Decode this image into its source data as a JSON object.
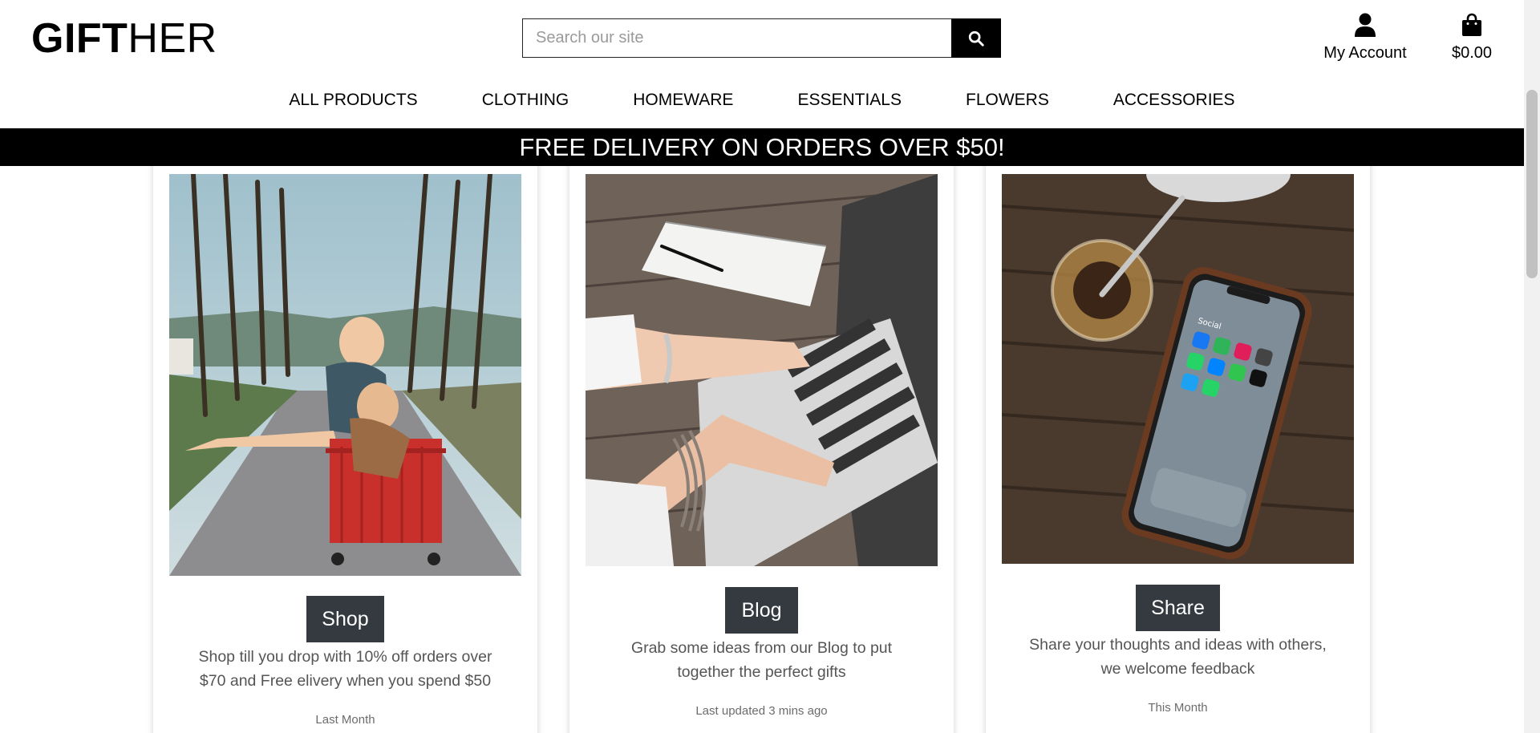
{
  "header": {
    "logo_bold": "GIFT",
    "logo_light": "HER",
    "search_placeholder": "Search our site",
    "account_label": "My Account",
    "cart_total": "$0.00"
  },
  "nav": {
    "items": [
      "ALL PRODUCTS",
      "CLOTHING",
      "HOMEWARE",
      "ESSENTIALS",
      "FLOWERS",
      "ACCESSORIES"
    ]
  },
  "banner": {
    "text": "FREE DELIVERY ON ORDERS OVER $50!"
  },
  "cards": [
    {
      "button": "Shop",
      "description": "Shop till you drop with 10% off orders over $70 and Free elivery when you spend $50",
      "meta": "Last Month"
    },
    {
      "button": "Blog",
      "description": "Grab some ideas from our Blog to put together the perfect gifts",
      "meta": "Last updated 3 mins ago"
    },
    {
      "button": "Share",
      "description": "Share your thoughts and ideas with others, we welcome feedback",
      "meta": "This Month"
    }
  ],
  "colors": {
    "button_bg": "#343a40",
    "banner_bg": "#000000",
    "text_muted": "#555555"
  }
}
